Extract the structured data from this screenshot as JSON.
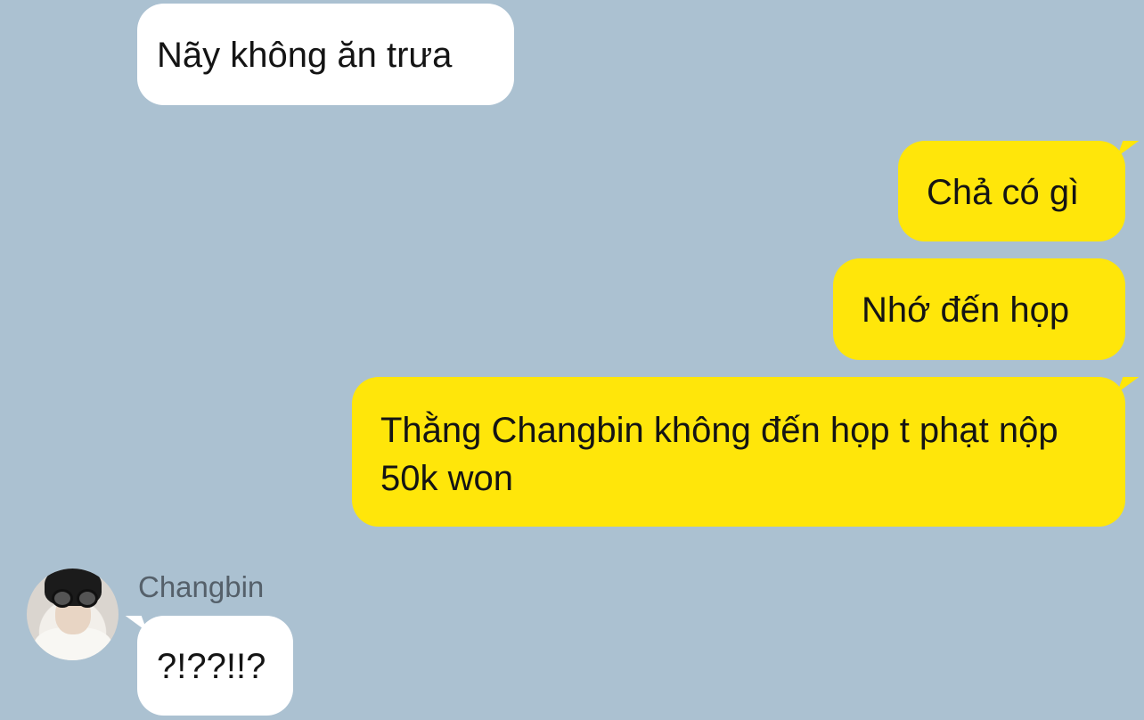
{
  "messages": [
    {
      "id": "m1",
      "direction": "incoming",
      "text": "Nãy không ăn trưa"
    },
    {
      "id": "m2",
      "direction": "outgoing",
      "text": "Chả có gì"
    },
    {
      "id": "m3",
      "direction": "outgoing",
      "text": "Nhớ đến họp"
    },
    {
      "id": "m4",
      "direction": "outgoing",
      "text": "Thằng Changbin không đến họp t phạt nộp 50k won"
    },
    {
      "id": "m5",
      "direction": "incoming",
      "sender": "Changbin",
      "text": "?!??!!?"
    }
  ],
  "colors": {
    "background": "#abc1d1",
    "incoming_bubble": "#ffffff",
    "outgoing_bubble": "#ffe60a",
    "text": "#141414",
    "sender_name": "#55606a"
  },
  "icons": {
    "avatar": "user-avatar-photo"
  }
}
